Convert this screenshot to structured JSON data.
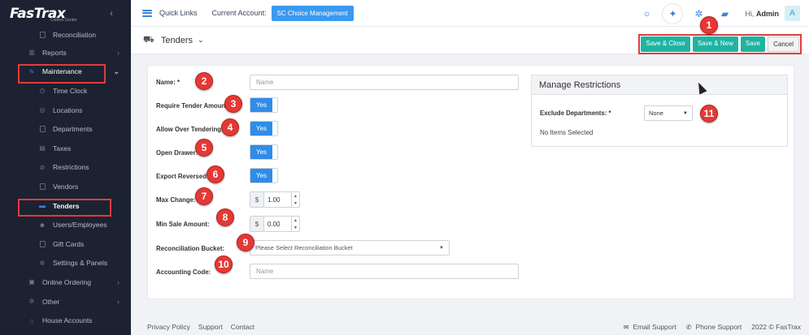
{
  "logo": {
    "text": "FasTrax",
    "subtitle": "Control Center"
  },
  "sidebar": {
    "items": [
      {
        "label": "Reconciliation",
        "icon": "calculator-icon"
      },
      {
        "label": "Reports",
        "icon": "chart-icon"
      },
      {
        "label": "Maintenance",
        "icon": "wrench-icon"
      },
      {
        "label": "Time Clock",
        "icon": "clock-icon"
      },
      {
        "label": "Locations",
        "icon": "location-icon"
      },
      {
        "label": "Departments",
        "icon": "departments-icon"
      },
      {
        "label": "Taxes",
        "icon": "tax-icon"
      },
      {
        "label": "Restrictions",
        "icon": "restriction-icon"
      },
      {
        "label": "Vendors",
        "icon": "vendor-icon"
      },
      {
        "label": "Tenders",
        "icon": "tenders-icon"
      },
      {
        "label": "Users/Employees",
        "icon": "users-icon"
      },
      {
        "label": "Gift Cards",
        "icon": "gift-icon"
      },
      {
        "label": "Settings & Panels",
        "icon": "gear-icon"
      },
      {
        "label": "Online Ordering",
        "icon": "cart-icon"
      },
      {
        "label": "Other",
        "icon": "gear-icon"
      },
      {
        "label": "House Accounts",
        "icon": "house-icon"
      }
    ]
  },
  "topbar": {
    "quick_links": "Quick Links",
    "account_label": "Current Account:",
    "account_value": "SC Choice Management",
    "greeting": "Hi,",
    "user": "Admin",
    "avatar": "A"
  },
  "header": {
    "title": "Tenders",
    "actions": [
      "Save & Close",
      "Save & New",
      "Save",
      "Cancel"
    ]
  },
  "form": {
    "name_label": "Name: *",
    "name_placeholder": "Name",
    "require_tender_label": "Require Tender Amount:",
    "allow_over_label": "Allow Over Tendering:",
    "open_drawer_label": "Open Drawer:",
    "export_reversed_label": "Export Reversed:",
    "toggle_on": "Yes",
    "max_change_label": "Max Change:",
    "max_change_prefix": "$",
    "max_change_value": "1.00",
    "min_sale_label": "Min Sale Amount:",
    "min_sale_prefix": "$",
    "min_sale_value": "0.00",
    "recon_label": "Reconciliation Bucket:",
    "recon_placeholder": "Please Select Reconciliation Bucket",
    "accounting_label": "Accounting Code:",
    "accounting_placeholder": "Name"
  },
  "restrictions": {
    "title": "Manage Restrictions",
    "exclude_label": "Exclude Departments: *",
    "exclude_value": "None",
    "empty_text": "No Items Selected"
  },
  "markers": [
    "1",
    "2",
    "3",
    "4",
    "5",
    "6",
    "7",
    "8",
    "9",
    "10",
    "11"
  ],
  "footer": {
    "links": [
      "Privacy Policy",
      "Support",
      "Contact"
    ],
    "email_support": "Email Support",
    "phone_support": "Phone Support",
    "copyright": "2022 © FasTrax"
  },
  "colors": {
    "sidebar": "#1d2232",
    "accent": "#2f8ce8",
    "teal": "#1fb3a1",
    "highlight": "#e03b3b"
  }
}
